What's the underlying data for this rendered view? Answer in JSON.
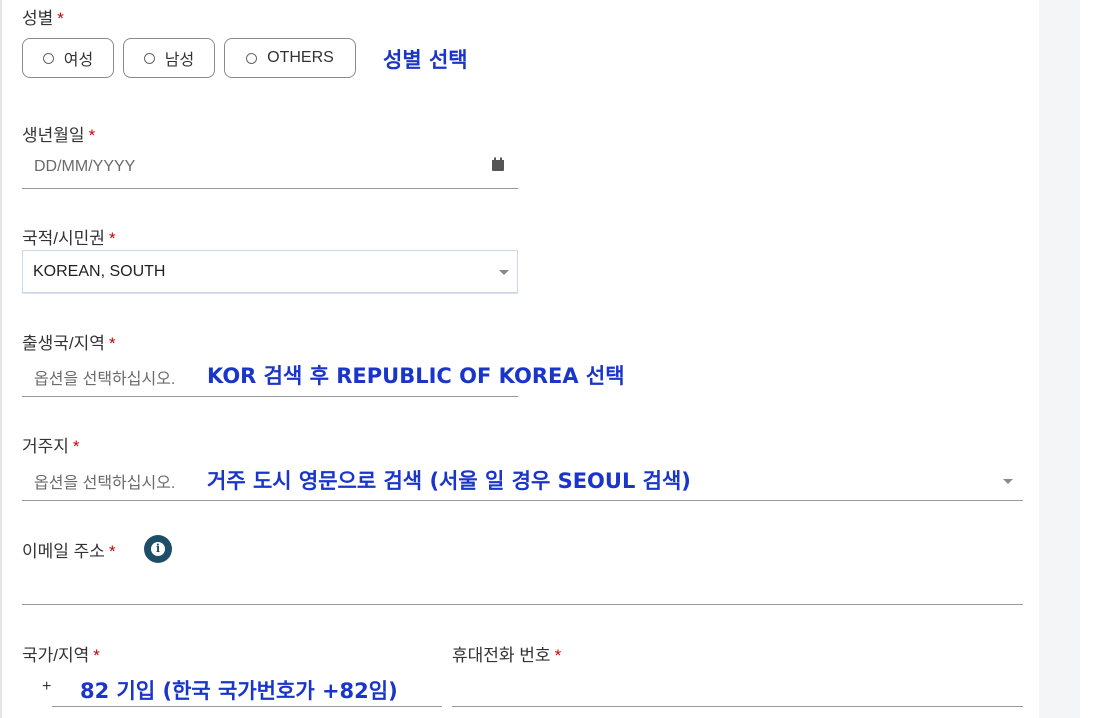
{
  "form": {
    "gender": {
      "label": "성별",
      "required": "*",
      "options": [
        "여성",
        "남성",
        "OTHERS"
      ],
      "note": "성별 선택"
    },
    "birthdate": {
      "label": "생년월일",
      "required": "*",
      "placeholder": "DD/MM/YYYY"
    },
    "nationality": {
      "label": "국적/시민권",
      "required": "*",
      "value": "KOREAN, SOUTH"
    },
    "birth_country": {
      "label": "출생국/지역",
      "required": "*",
      "placeholder": "옵션을 선택하십시오.",
      "note": "KOR 검색 후 REPUBLIC OF KOREA 선택"
    },
    "residence": {
      "label": "거주지",
      "required": "*",
      "placeholder": "옵션을 선택하십시오.",
      "note": "거주 도시 영문으로 검색 (서울 일 경우 SEOUL 검색)"
    },
    "email": {
      "label": "이메일 주소",
      "required": "*",
      "info_icon_glyph": "i"
    },
    "country_code": {
      "label": "국가/지역",
      "required": "*",
      "prefix": "+",
      "note": "82 기입 (한국 국가번호가 +82임)"
    },
    "mobile": {
      "label": "휴대전화 번호",
      "required": "*"
    }
  },
  "icons": {
    "calendar": "calendar-icon",
    "dropdown": "chevron-down-icon",
    "info": "info-icon"
  },
  "colors": {
    "note_blue": "#1a35c9",
    "required_red": "#cc0000",
    "info_icon": "#1e4e67"
  }
}
